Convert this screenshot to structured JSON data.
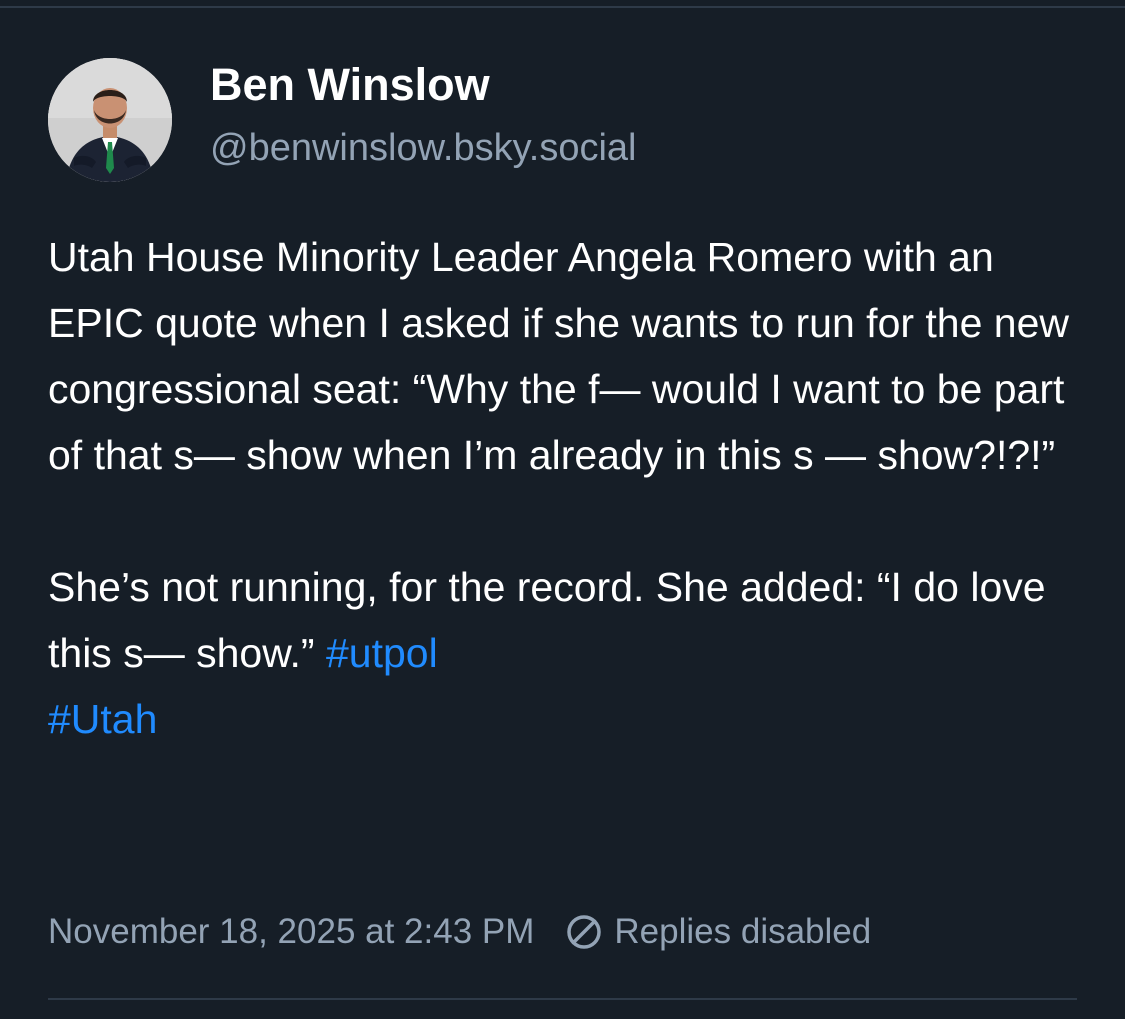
{
  "post": {
    "author": {
      "display_name": "Ben Winslow",
      "handle": "@benwinslow.bsky.social",
      "avatar_icon": "user-avatar-photo"
    },
    "body": {
      "paragraph_1": "Utah House Minority Leader Angela Romero with an EPIC quote when I asked if she wants to run for the new congressional seat: “Why the f— would I want to be part of that s— show when I’m already in this s — show?!?!”",
      "paragraph_2_text": "She’s not running, for the record. She added: “I do love this s— show.” ",
      "hashtags": [
        "#utpol",
        "#Utah"
      ]
    },
    "timestamp": "November 18, 2025 at 2:43 PM",
    "replies_status": "Replies disabled",
    "replies_icon": "replies-disabled-icon",
    "colors": {
      "background": "#161e27",
      "text": "#ffffff",
      "secondary_text": "#93a3b5",
      "hashtag": "#208bfe",
      "divider": "#2e3a48"
    }
  }
}
